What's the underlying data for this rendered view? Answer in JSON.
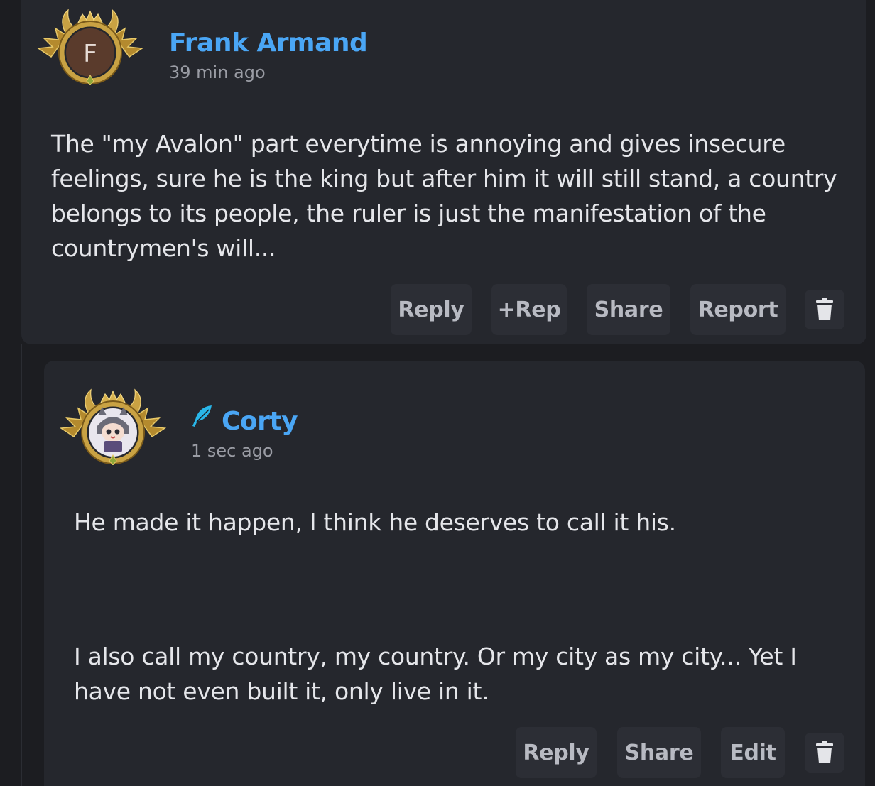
{
  "comments": [
    {
      "author": "Frank Armand",
      "avatar_initial": "F",
      "time": "39 min ago",
      "text": "The \"my Avalon\" part everytime is annoying and gives insecure feelings, sure he is the king but after him it will still stand, a country belongs to its people, the ruler is just the manifestation of the countrymen's will...",
      "actions": {
        "reply": "Reply",
        "rep": "+Rep",
        "share": "Share",
        "report": "Report"
      }
    },
    {
      "author": "Corty",
      "time": "1 sec ago",
      "paragraphs": [
        "He made it happen, I think he deserves to call it his.",
        "I also call my country, my country. Or my city as my city... Yet I have not even built it, only live in it."
      ],
      "actions": {
        "reply": "Reply",
        "share": "Share",
        "edit": "Edit"
      }
    }
  ],
  "colors": {
    "background": "#1c1d21",
    "card": "#25272d",
    "button": "#2c2e35",
    "username": "#4aa6f5",
    "feather": "#29b6e8",
    "frame_gold": "#c9a243",
    "avatar_bg": "#5a3b2c"
  },
  "icons": {
    "delete": "trash-icon",
    "author_badge": "feather-icon",
    "avatar_frame": "gold-crown-frame"
  }
}
